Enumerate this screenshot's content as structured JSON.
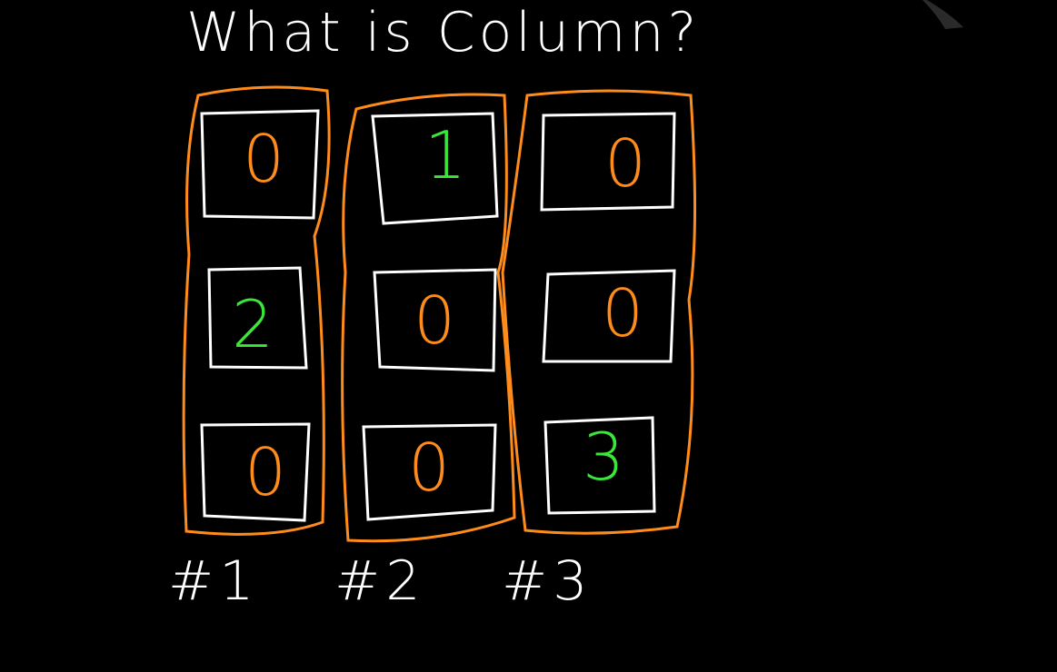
{
  "title": "What is Column?",
  "columns": [
    {
      "label": "#1",
      "cells": [
        "0",
        "2",
        "0"
      ]
    },
    {
      "label": "#2",
      "cells": [
        "1",
        "0",
        "0"
      ]
    },
    {
      "label": "#3",
      "cells": [
        "0",
        "0",
        "3"
      ]
    }
  ],
  "colors": {
    "background": "#000000",
    "box_stroke": "#ffffff",
    "column_outline": "#ff8c1a",
    "zero_digit": "#ff8c1a",
    "nonzero_digit": "#39e639"
  }
}
